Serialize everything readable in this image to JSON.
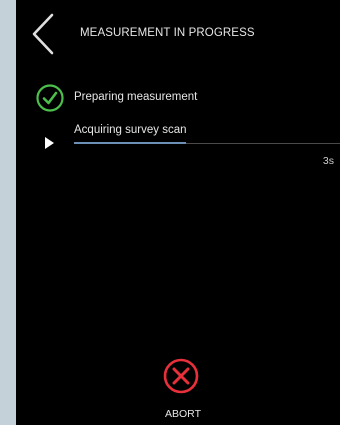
{
  "header": {
    "title": "MEASUREMENT IN PROGRESS",
    "back_icon": "chevron-left-icon"
  },
  "steps": [
    {
      "label": "Preparing measurement",
      "status": "completed",
      "icon": "check-circle-icon"
    },
    {
      "label": "Acquiring survey scan",
      "status": "in-progress",
      "icon": "play-icon",
      "progress": 0.42,
      "time_remaining": "3s"
    }
  ],
  "abort": {
    "label": "ABORT",
    "icon": "close-circle-icon"
  },
  "colors": {
    "screen_background": "#000000",
    "page_background": "#c5d1d9",
    "check": "#4cbf4c",
    "abort": "#e8303a",
    "progress": "#6b8fb5",
    "text": "#e6e6e6"
  }
}
